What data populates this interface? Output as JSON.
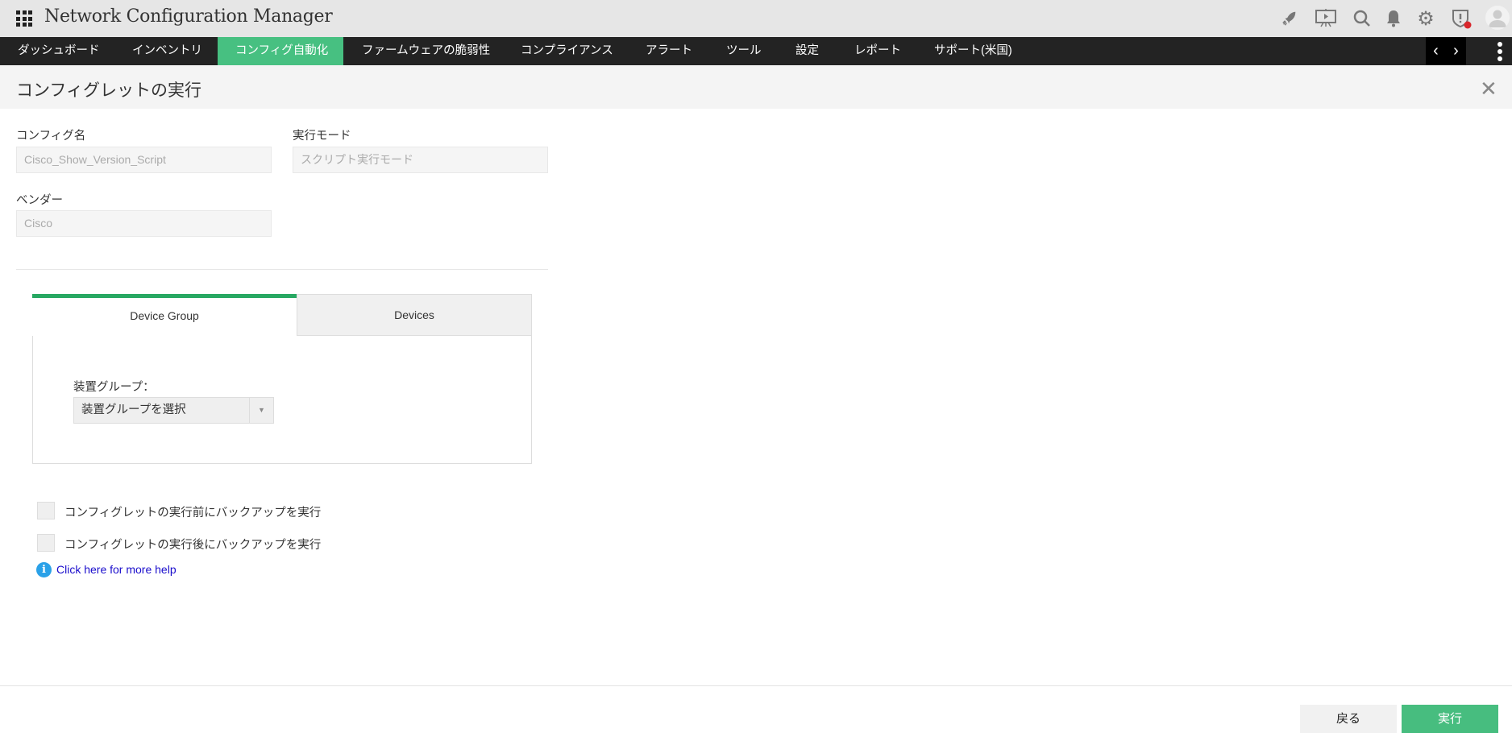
{
  "app": {
    "title": "Network Configuration Manager"
  },
  "header_icons": [
    "rocket-icon",
    "presentation-icon",
    "search-icon",
    "bell-icon",
    "gear-icon",
    "shield-alert-icon",
    "avatar-icon"
  ],
  "nav": {
    "items": [
      "ダッシュボード",
      "インベントリ",
      "コンフィグ自動化",
      "ファームウェアの脆弱性",
      "コンプライアンス",
      "アラート",
      "ツール",
      "設定",
      "レポート",
      "サポート(米国)"
    ],
    "active": "コンフィグ自動化"
  },
  "page": {
    "title": "コンフィグレットの実行"
  },
  "form": {
    "config_name_label": "コンフィグ名",
    "config_name_value": "Cisco_Show_Version_Script",
    "mode_label": "実行モード",
    "mode_value": "スクリプト実行モード",
    "vendor_label": "ベンダー",
    "vendor_value": "Cisco"
  },
  "tabs": [
    {
      "label": "Device Group"
    },
    {
      "label": "Devices"
    }
  ],
  "device_group": {
    "label": "装置グループ：",
    "select_value": "装置グループを選択"
  },
  "options": [
    {
      "label": "コンフィグレットの実行前にバックアップを実行",
      "checked": false
    },
    {
      "label": "コンフィグレットの実行後にバックアップを実行",
      "checked": false
    }
  ],
  "help_link": "Click here for more help",
  "footer": {
    "back": "戻る",
    "run": "実行"
  },
  "colors": {
    "accent": "#47c081",
    "nav_bg": "#232323",
    "tab_indicator": "#27a862",
    "link": "#1a0dcc"
  }
}
